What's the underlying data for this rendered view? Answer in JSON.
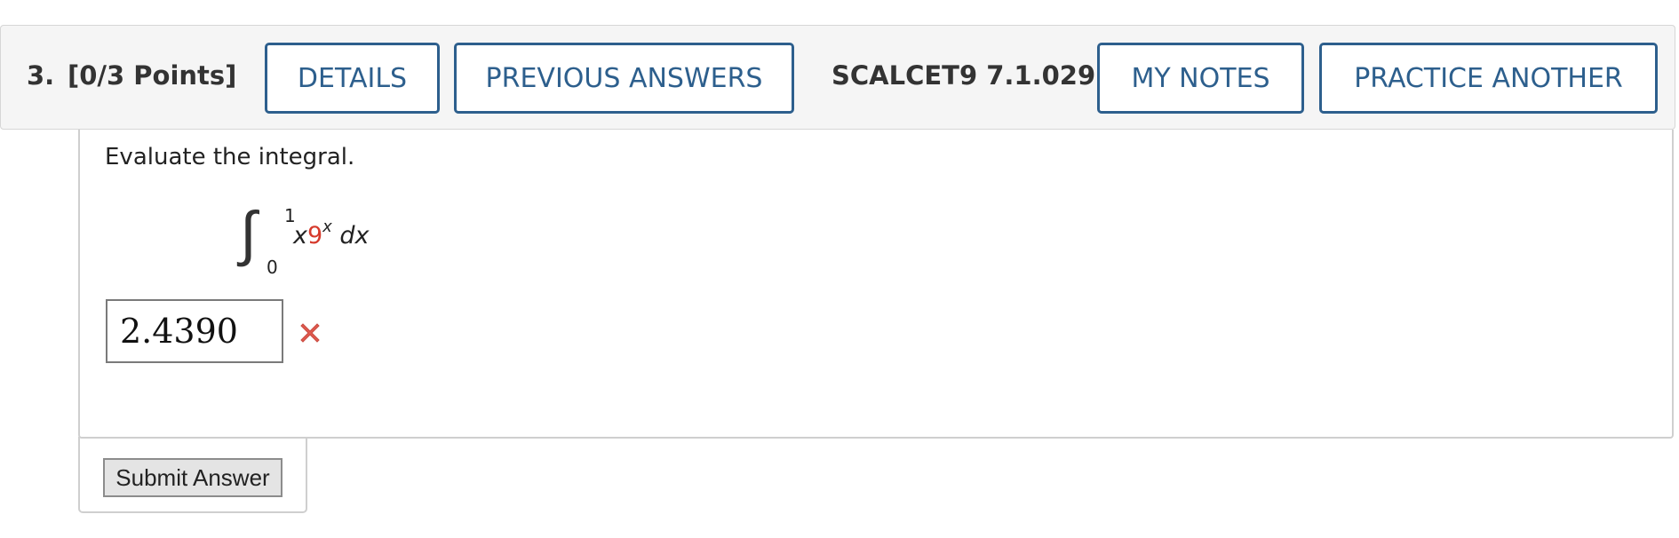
{
  "question": {
    "number": "3.",
    "points": "[0/3 Points]",
    "code": "SCALCET9 7.1.029."
  },
  "header_buttons": {
    "details": "DETAILS",
    "previous_answers": "PREVIOUS ANSWERS",
    "my_notes": "MY NOTES",
    "practice_another": "PRACTICE ANOTHER"
  },
  "problem": {
    "prompt": "Evaluate the integral.",
    "lower_limit": "0",
    "upper_limit": "1",
    "integrand_var": "x",
    "integrand_base": "9",
    "integrand_exponent": "x",
    "differential": "dx"
  },
  "answer": {
    "value": "2.4390",
    "status_icon": "incorrect-x-icon"
  },
  "submit_label": "Submit Answer",
  "colors": {
    "accent": "#2d5f8d",
    "highlight": "#d63a2c",
    "incorrect": "#e05a4f"
  }
}
